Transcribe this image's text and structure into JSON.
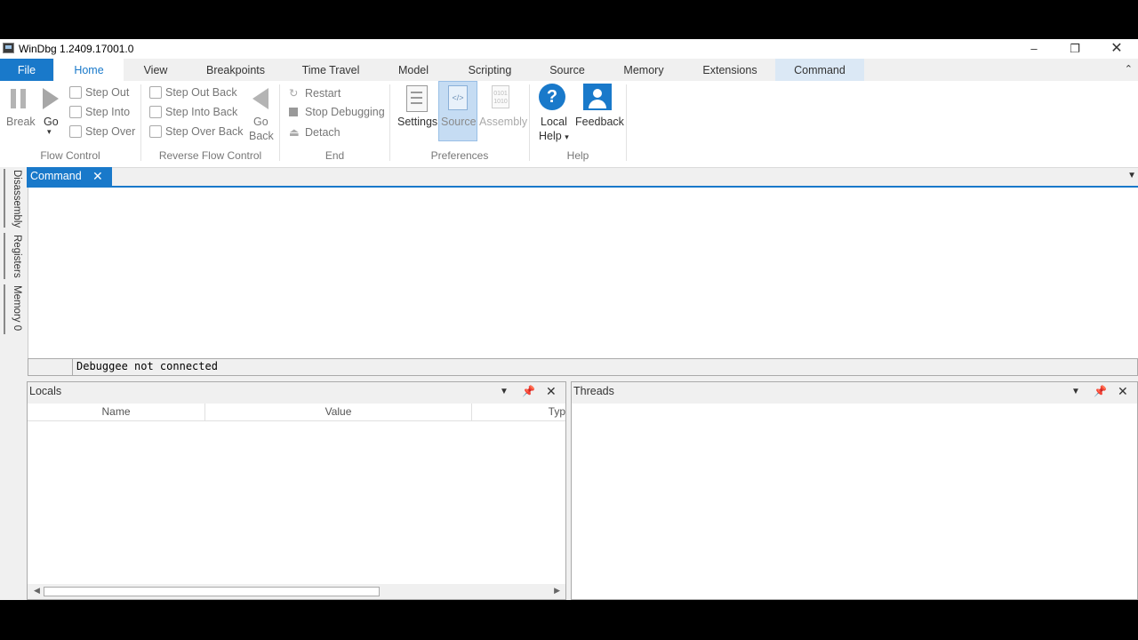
{
  "window": {
    "title": "WinDbg 1.2409.17001.0"
  },
  "menu_tabs": [
    "File",
    "Home",
    "View",
    "Breakpoints",
    "Time Travel",
    "Model",
    "Scripting",
    "Source",
    "Memory",
    "Extensions",
    "Command"
  ],
  "ribbon": {
    "flow_control": {
      "label": "Flow Control",
      "break": "Break",
      "go": "Go",
      "step_out": "Step Out",
      "step_into": "Step Into",
      "step_over": "Step Over"
    },
    "reverse_flow_control": {
      "label": "Reverse Flow Control",
      "step_out_back": "Step Out Back",
      "step_into_back": "Step Into Back",
      "step_over_back": "Step Over Back",
      "go_back_1": "Go",
      "go_back_2": "Back"
    },
    "end": {
      "label": "End",
      "restart": "Restart",
      "stop": "Stop Debugging",
      "detach": "Detach"
    },
    "preferences": {
      "label": "Preferences",
      "settings": "Settings",
      "source": "Source",
      "assembly": "Assembly"
    },
    "help": {
      "label": "Help",
      "local_help_1": "Local",
      "local_help_2": "Help",
      "feedback": "Feedback"
    }
  },
  "side_tabs": [
    "Disassembly",
    "Registers",
    "Memory 0"
  ],
  "command_window": {
    "tab_label": "Command",
    "status": "Debuggee not connected"
  },
  "locals": {
    "title": "Locals",
    "columns": [
      "Name",
      "Value",
      "Typ"
    ]
  },
  "threads": {
    "title": "Threads"
  },
  "colors": {
    "accent": "#1979ca",
    "selected_tab_bg": "#dbe8f5"
  }
}
